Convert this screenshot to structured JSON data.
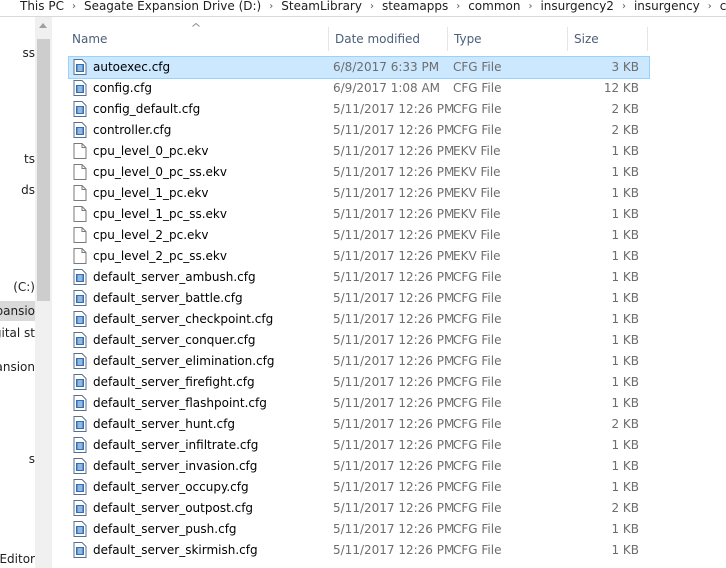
{
  "breadcrumb": [
    "This PC",
    "Seagate Expansion Drive (D:)",
    "SteamLibrary",
    "steamapps",
    "common",
    "insurgency2",
    "insurgency",
    "cfg"
  ],
  "nav_items": [
    "ss",
    "ts",
    "ds",
    "(C:)",
    "xpansio",
    "gital st",
    "pansion",
    "s",
    "e Editor"
  ],
  "columns": {
    "name": "Name",
    "date": "Date modified",
    "type": "Type",
    "size": "Size"
  },
  "files": [
    {
      "name": "autoexec.cfg",
      "date": "6/8/2017 6:33 PM",
      "type": "CFG File",
      "size": "3 KB",
      "icon": "config-file-icon",
      "selected": true
    },
    {
      "name": "config.cfg",
      "date": "6/9/2017 1:08 AM",
      "type": "CFG File",
      "size": "12 KB",
      "icon": "config-file-icon"
    },
    {
      "name": "config_default.cfg",
      "date": "5/11/2017 12:26 PM",
      "type": "CFG File",
      "size": "2 KB",
      "icon": "config-file-icon"
    },
    {
      "name": "controller.cfg",
      "date": "5/11/2017 12:26 PM",
      "type": "CFG File",
      "size": "2 KB",
      "icon": "config-file-icon"
    },
    {
      "name": "cpu_level_0_pc.ekv",
      "date": "5/11/2017 12:26 PM",
      "type": "EKV File",
      "size": "1 KB",
      "icon": "blank-file-icon"
    },
    {
      "name": "cpu_level_0_pc_ss.ekv",
      "date": "5/11/2017 12:26 PM",
      "type": "EKV File",
      "size": "1 KB",
      "icon": "blank-file-icon"
    },
    {
      "name": "cpu_level_1_pc.ekv",
      "date": "5/11/2017 12:26 PM",
      "type": "EKV File",
      "size": "1 KB",
      "icon": "blank-file-icon"
    },
    {
      "name": "cpu_level_1_pc_ss.ekv",
      "date": "5/11/2017 12:26 PM",
      "type": "EKV File",
      "size": "1 KB",
      "icon": "blank-file-icon"
    },
    {
      "name": "cpu_level_2_pc.ekv",
      "date": "5/11/2017 12:26 PM",
      "type": "EKV File",
      "size": "1 KB",
      "icon": "blank-file-icon"
    },
    {
      "name": "cpu_level_2_pc_ss.ekv",
      "date": "5/11/2017 12:26 PM",
      "type": "EKV File",
      "size": "1 KB",
      "icon": "blank-file-icon"
    },
    {
      "name": "default_server_ambush.cfg",
      "date": "5/11/2017 12:26 PM",
      "type": "CFG File",
      "size": "1 KB",
      "icon": "config-file-icon"
    },
    {
      "name": "default_server_battle.cfg",
      "date": "5/11/2017 12:26 PM",
      "type": "CFG File",
      "size": "1 KB",
      "icon": "config-file-icon"
    },
    {
      "name": "default_server_checkpoint.cfg",
      "date": "5/11/2017 12:26 PM",
      "type": "CFG File",
      "size": "1 KB",
      "icon": "config-file-icon"
    },
    {
      "name": "default_server_conquer.cfg",
      "date": "5/11/2017 12:26 PM",
      "type": "CFG File",
      "size": "1 KB",
      "icon": "config-file-icon"
    },
    {
      "name": "default_server_elimination.cfg",
      "date": "5/11/2017 12:26 PM",
      "type": "CFG File",
      "size": "1 KB",
      "icon": "config-file-icon"
    },
    {
      "name": "default_server_firefight.cfg",
      "date": "5/11/2017 12:26 PM",
      "type": "CFG File",
      "size": "1 KB",
      "icon": "config-file-icon"
    },
    {
      "name": "default_server_flashpoint.cfg",
      "date": "5/11/2017 12:26 PM",
      "type": "CFG File",
      "size": "1 KB",
      "icon": "config-file-icon"
    },
    {
      "name": "default_server_hunt.cfg",
      "date": "5/11/2017 12:26 PM",
      "type": "CFG File",
      "size": "2 KB",
      "icon": "config-file-icon"
    },
    {
      "name": "default_server_infiltrate.cfg",
      "date": "5/11/2017 12:26 PM",
      "type": "CFG File",
      "size": "1 KB",
      "icon": "config-file-icon"
    },
    {
      "name": "default_server_invasion.cfg",
      "date": "5/11/2017 12:26 PM",
      "type": "CFG File",
      "size": "1 KB",
      "icon": "config-file-icon"
    },
    {
      "name": "default_server_occupy.cfg",
      "date": "5/11/2017 12:26 PM",
      "type": "CFG File",
      "size": "1 KB",
      "icon": "config-file-icon"
    },
    {
      "name": "default_server_outpost.cfg",
      "date": "5/11/2017 12:26 PM",
      "type": "CFG File",
      "size": "2 KB",
      "icon": "config-file-icon"
    },
    {
      "name": "default_server_push.cfg",
      "date": "5/11/2017 12:26 PM",
      "type": "CFG File",
      "size": "1 KB",
      "icon": "config-file-icon"
    },
    {
      "name": "default_server_skirmish.cfg",
      "date": "5/11/2017 12:26 PM",
      "type": "CFG File",
      "size": "1 KB",
      "icon": "config-file-icon"
    }
  ],
  "colors": {
    "selection": "#cce8ff",
    "header_text": "#4c607a",
    "meta_text": "#6d6d6d"
  }
}
